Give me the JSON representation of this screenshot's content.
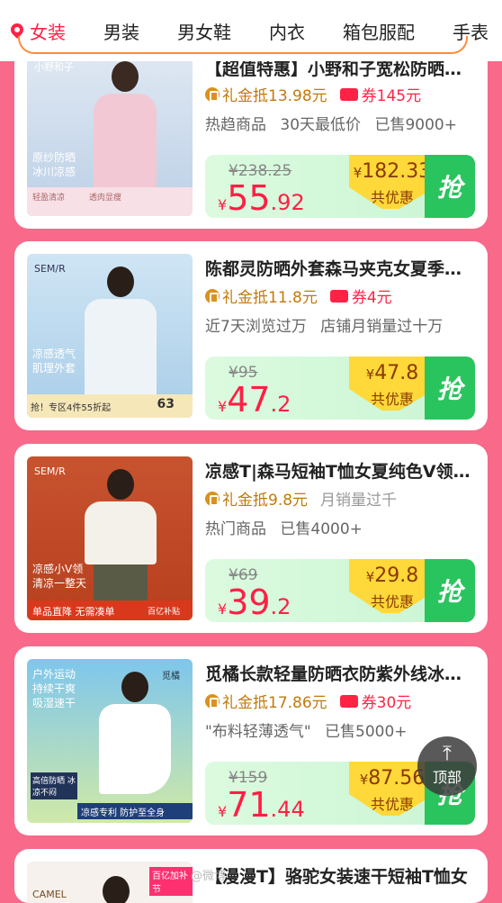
{
  "tabs": [
    "女装",
    "男装",
    "男女鞋",
    "内衣",
    "箱包服配",
    "手表"
  ],
  "products": [
    {
      "title": "【超值特惠】小野和子宽松防晒外套",
      "gift": "礼金抵13.98元",
      "coupon": "券145元",
      "tags": [
        "热趋商品",
        "30天最低价",
        "已售9000+"
      ],
      "original_price": "¥238.25",
      "price_int": "55",
      "price_dec": ".92",
      "coupon_price": "182.33",
      "coupon_label": "共优惠",
      "action": "抢",
      "image": {
        "brand": "小野和子",
        "line1": "原纱防晒",
        "line2": "冰川凉感",
        "bottom": "轻盈清凉　　　透肉显瘦"
      }
    },
    {
      "title": "陈都灵防晒外套森马夹克女夏季新款",
      "gift": "礼金抵11.8元",
      "coupon": "券4元",
      "tags": [
        "近7天浏览过万",
        "店铺月销量过十万"
      ],
      "original_price": "¥95",
      "price_int": "47",
      "price_dec": ".2",
      "coupon_price": "47.8",
      "coupon_label": "共优惠",
      "action": "抢",
      "image": {
        "brand": "SEM/R",
        "line1": "凉感透气",
        "line2": "肌理外套",
        "bottom": "抢！专区4件55折起",
        "badge": "63"
      }
    },
    {
      "title": "凉感T|森马短袖T恤女夏纯色V领上衣",
      "gift": "礼金抵9.8元",
      "coupon": "",
      "tags_first": "月销量过千",
      "tags": [
        "热门商品",
        "已售4000+"
      ],
      "original_price": "¥69",
      "price_int": "39",
      "price_dec": ".2",
      "coupon_price": "29.8",
      "coupon_label": "共优惠",
      "action": "抢",
      "image": {
        "brand": "SEM/R",
        "line1": "凉感小V领",
        "line2": "清凉一整天",
        "bottom": "单品直降 无需凑单",
        "badge": "百亿补贴"
      }
    },
    {
      "title": "觅橘长款轻量防晒衣防紫外线冰丝外套",
      "gift": "礼金抵17.86元",
      "coupon": "券30元",
      "tags": [
        "\"布料轻薄透气\"",
        "已售5000+"
      ],
      "original_price": "¥159",
      "price_int": "71",
      "price_dec": ".44",
      "coupon_price": "87.56",
      "coupon_label": "共优惠",
      "action": "抢",
      "image": {
        "brand": "觅橘",
        "line1": "户外运动",
        "line2": "持续干爽",
        "line3": "吸湿速干",
        "bottom": "凉感专利 防护至全身",
        "side": "高倍防晒 冰凉不闷"
      }
    },
    {
      "title": "【漫漫T】骆驼女装速干短袖T恤女",
      "image": {
        "brand": "CAMEL",
        "badge": "百亿加补节"
      }
    }
  ],
  "top_button": "顶部",
  "watermark": "@微博"
}
